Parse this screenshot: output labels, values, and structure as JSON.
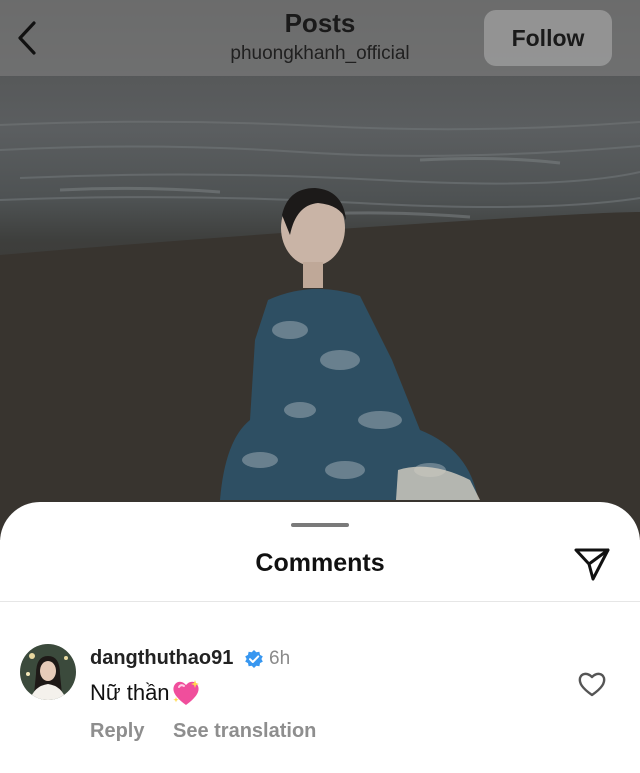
{
  "header": {
    "title": "Posts",
    "username": "phuongkhanh_official",
    "follow_label": "Follow"
  },
  "comments_sheet": {
    "title": "Comments",
    "comments": [
      {
        "username": "dangthuthao91",
        "verified": true,
        "time": "6h",
        "text": "Nữ thần",
        "emoji": "sparkling-heart",
        "reply_label": "Reply",
        "translate_label": "See translation"
      }
    ]
  },
  "colors": {
    "verified_badge": "#3897f0",
    "heart_emoji": "#f04e9c",
    "secondary_text": "#8e8e8e"
  }
}
